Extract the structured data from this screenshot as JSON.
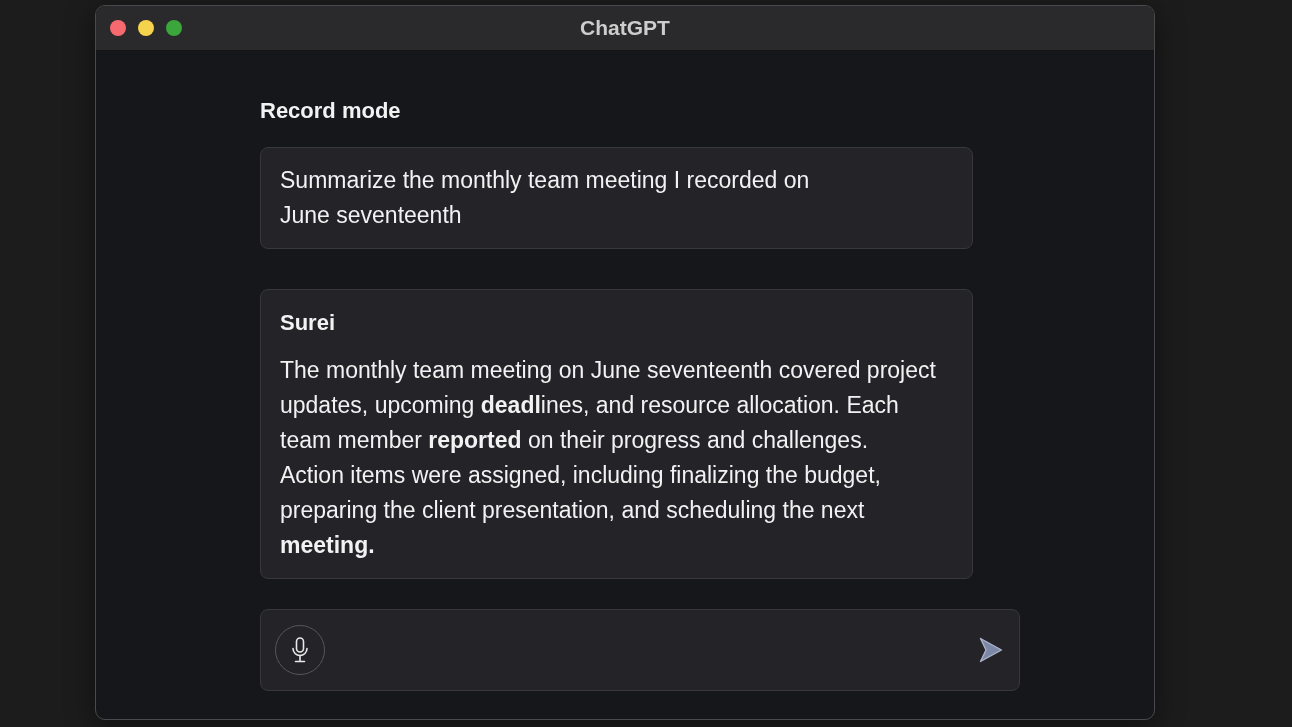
{
  "window": {
    "title": "ChatGPT"
  },
  "mode_title": "Record mode",
  "messages": [
    {
      "kind": "prompt",
      "text": "Summarize the monthly team meeting I recorded on\nJune seventeenth"
    },
    {
      "kind": "reply",
      "sender": "Surei",
      "text": "The monthly team meeting on June seventeenth covered project updates, upcoming **deadl**ines, and resource allocation. Each team member **reported** on their progress and challenges.\nAction items were assigned, including finalizing the budget, preparing the client presentation, and scheduling the next **meeting.**"
    }
  ]
}
